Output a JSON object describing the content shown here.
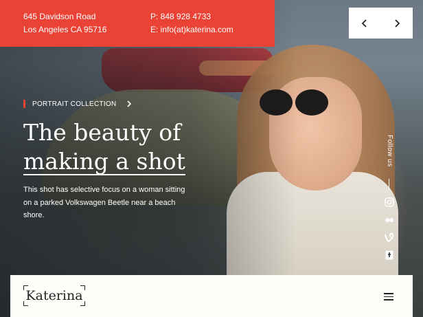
{
  "contact": {
    "address_line1": "645 Davidson Road",
    "address_line2": "Los Angeles CA 95716",
    "phone": "P: 848 928 4733",
    "email": "E: info(at)katerina.com"
  },
  "hero": {
    "eyebrow": "PORTRAIT COLLECTION",
    "title_line1": "The beauty of",
    "title_line2": "making a shot",
    "description": "This shot has selective focus on a woman sitting on a parked Volkswagen Beetle near a beach shore."
  },
  "social": {
    "follow_label": "Follow us",
    "icons": [
      "instagram-icon",
      "flickr-icon",
      "vine-icon",
      "tumblr-icon"
    ]
  },
  "brand": {
    "logo_text": "Katerina"
  },
  "colors": {
    "accent": "#ea4336",
    "bar_bg": "#fffefb",
    "text_dark": "#222222"
  }
}
